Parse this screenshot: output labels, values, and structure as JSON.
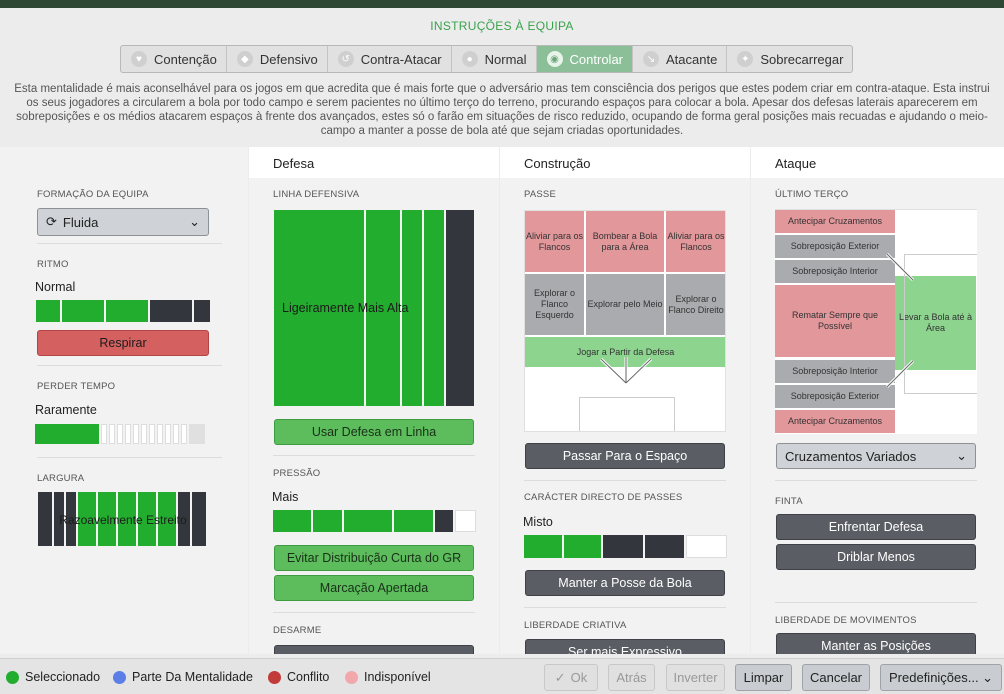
{
  "title": "INSTRUÇÕES À EQUIPA",
  "tabs": [
    {
      "label": "Contenção",
      "icon": "shield-heart-icon"
    },
    {
      "label": "Defensivo",
      "icon": "shield-icon"
    },
    {
      "label": "Contra-Atacar",
      "icon": "counter-icon"
    },
    {
      "label": "Normal",
      "icon": "circle-icon"
    },
    {
      "label": "Controlar",
      "icon": "control-icon",
      "active": true
    },
    {
      "label": "Atacante",
      "icon": "attack-arrow-icon"
    },
    {
      "label": "Sobrecarregar",
      "icon": "overload-icon"
    }
  ],
  "description": "Esta mentalidade é mais aconselhável para os jogos em que acredita que é mais forte que o adversário mas tem consciência dos perigos que estes podem criar em contra-ataque. Esta instrui os seus jogadores a circularem a bola por todo campo e serem pacientes no último terço do terreno, procurando espaços para colocar a bola. Apesar dos defesas laterais aparecerem em sobreposições e os médios atacarem espaços à frente dos avançados, estes só o farão em situações de risco reduzido, ocupando de forma geral posições mais recuadas e ajudando o meio-campo a manter a posse de bola até que sejam criadas oportunidades.",
  "panel1": {
    "formacao_label": "FORMAÇÃO DA EQUIPA",
    "formacao_value": "Fluida",
    "ritmo_label": "RITMO",
    "ritmo_value": "Normal",
    "ritmo_level": 0.6,
    "respirar": "Respirar",
    "perder_label": "PERDER TEMPO",
    "perder_value": "Raramente",
    "perder_level": 0.35,
    "largura_label": "LARGURA",
    "largura_value": "Razoavelmente Estreito"
  },
  "defesa": {
    "header": "Defesa",
    "linha_label": "LINHA DEFENSIVA",
    "linha_value": "Ligeiramente Mais Alta",
    "usar_defesa": "Usar Defesa em Linha",
    "pressao_label": "PRESSÃO",
    "pressao_value": "Mais",
    "evitar": "Evitar Distribuição Curta do GR",
    "marcacao": "Marcação Apertada",
    "desarme_label": "DESARME"
  },
  "construcao": {
    "header": "Construção",
    "passe_label": "PASSE",
    "zones": [
      "Aliviar para os Flancos",
      "Bombear a Bola para a Área",
      "Aliviar para os Flancos",
      "Explorar o Flanco Esquerdo",
      "Explorar pelo Meio",
      "Explorar o Flanco Direito",
      "Jogar a Partir da Defesa"
    ],
    "passar_espaco": "Passar Para o Espaço",
    "caracter_label": "CARÁCTER DIRECTO DE PASSES",
    "caracter_value": "Misto",
    "manter_posse": "Manter a Posse da Bola",
    "liberdade_label": "LIBERDADE CRIATIVA",
    "expressivo": "Ser mais Expressivo"
  },
  "ataque": {
    "header": "Ataque",
    "terco_label": "ÚLTIMO TERÇO",
    "zones": [
      "Antecipar Cruzamentos",
      "Sobreposição Exterior",
      "Sobreposição Interior",
      "Rematar Sempre que Possível",
      "Sobreposição Interior",
      "Sobreposição Exterior",
      "Antecipar Cruzamentos",
      "Levar a Bola até à Área"
    ],
    "cruzamentos": "Cruzamentos Variados",
    "finta_label": "FINTA",
    "enfrentar": "Enfrentar Defesa",
    "driblar": "Driblar Menos",
    "liberdade_label": "LIBERDADE DE MOVIMENTOS",
    "manter_posicoes": "Manter as Posições"
  },
  "legend": [
    {
      "label": "Seleccionado",
      "color": "#22ad2e"
    },
    {
      "label": "Parte Da Mentalidade",
      "color": "#5b7fe6"
    },
    {
      "label": "Conflito",
      "color": "#c23a3a"
    },
    {
      "label": "Indisponível",
      "color": "#f2a8aa"
    }
  ],
  "footer": {
    "ok": "Ok",
    "atras": "Atrás",
    "inverter": "Inverter",
    "limpar": "Limpar",
    "cancelar": "Cancelar",
    "predefinicoes": "Predefinições..."
  }
}
